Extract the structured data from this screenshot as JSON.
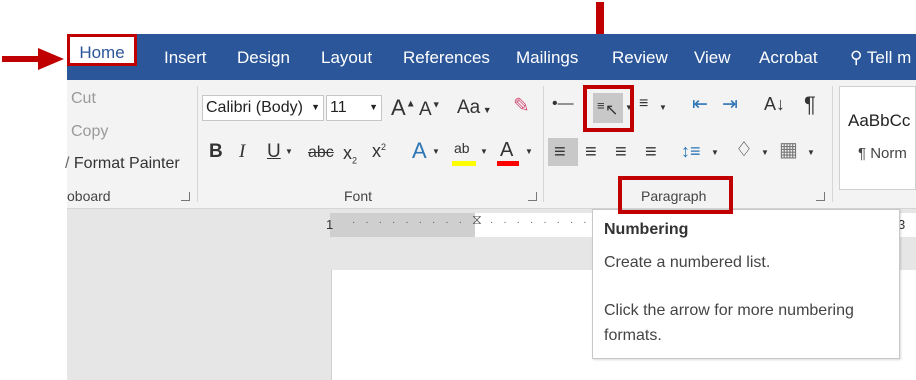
{
  "tabs": {
    "home": "Home",
    "insert": "Insert",
    "design": "Design",
    "layout": "Layout",
    "references": "References",
    "mailings": "Mailings",
    "review": "Review",
    "view": "View",
    "acrobat": "Acrobat",
    "tell_me": "Tell m"
  },
  "clipboard": {
    "cut": "Cut",
    "copy": "Copy",
    "format_painter": "Format Painter",
    "label": "oboard"
  },
  "font": {
    "family": "Calibri (Body)",
    "size": "11",
    "change_case": "Aa",
    "strike": "abc",
    "label": "Font"
  },
  "paragraph": {
    "label": "Paragraph"
  },
  "styles": {
    "preview": "AaBbCc",
    "normal": "¶ Norm"
  },
  "ruler": {
    "left_number": "1",
    "right_number": "3"
  },
  "tooltip": {
    "title": "Numbering",
    "line1": "Create a numbered list.",
    "line2": "Click the arrow for more numbering",
    "line3": "formats."
  },
  "colors": {
    "tab_bar": "#2b579a",
    "annotation_red": "#c00000",
    "ribbon_bg": "#f3f3f3"
  }
}
